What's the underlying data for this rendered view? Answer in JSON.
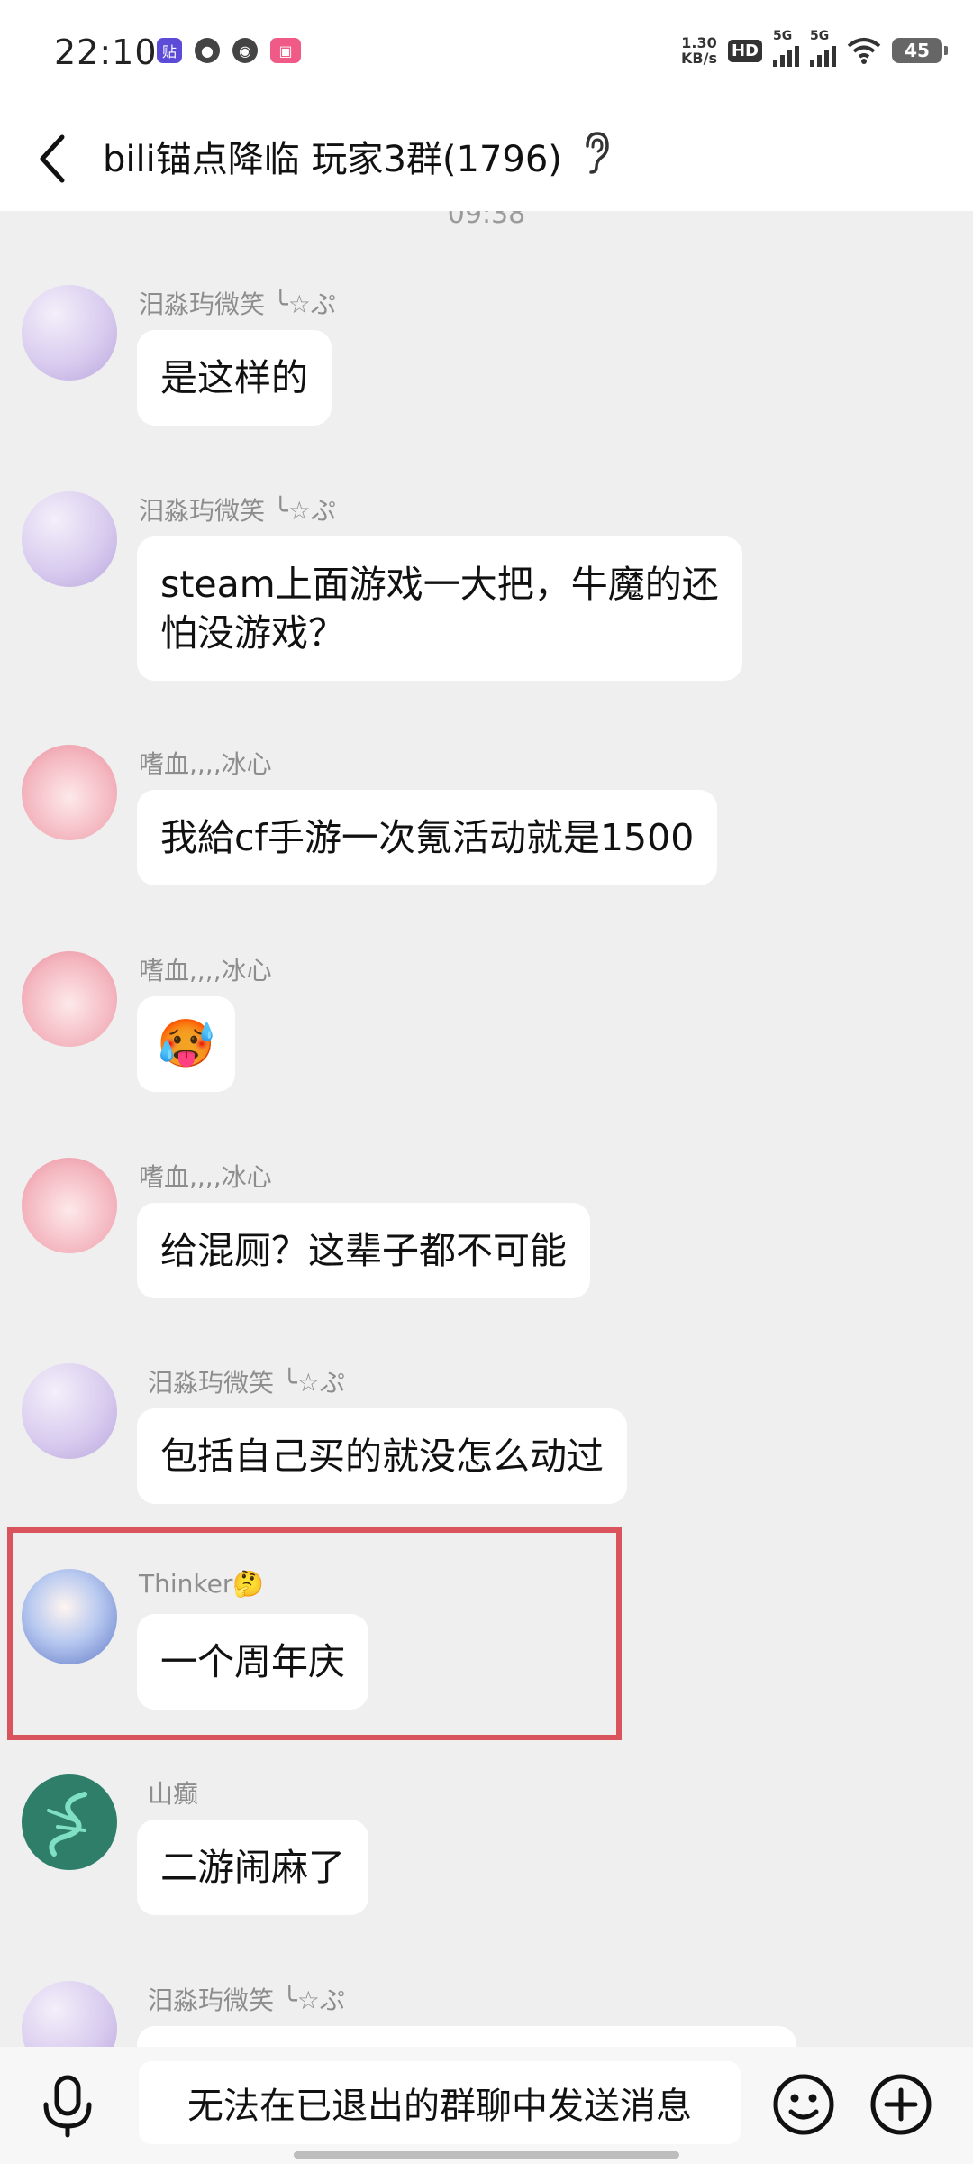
{
  "status_bar": {
    "time": "22:10",
    "net_speed_value": "1.30",
    "net_speed_unit": "KB/s",
    "hd_label": "HD",
    "signal_1_label": "5G",
    "signal_2_label": "5G",
    "battery": "45",
    "app_icons": [
      "tieba-icon",
      "message-icon",
      "wechat-icon",
      "bilibili-icon"
    ]
  },
  "header": {
    "title": "bili锚点降临 玩家3群(1796)",
    "ear_icon": "ear-icon"
  },
  "chat": {
    "timestamp": "09:38",
    "messages": [
      {
        "sender": "汨淼玙微笑 ╰☆ぷ",
        "text": "是这样的"
      },
      {
        "sender": "汨淼玙微笑 ╰☆ぷ",
        "text": "steam上面游戏一大把，牛魔的还\n怕没游戏？"
      },
      {
        "sender": "嗜血,,,,冰心",
        "text": "我給cf手游一次氪活动就是1500"
      },
      {
        "sender": "嗜血,,,,冰心",
        "text": "🥵"
      },
      {
        "sender": "嗜血,,,,冰心",
        "text": "给混厕？这辈子都不可能"
      },
      {
        "sender": "汨淼玙微笑 ╰☆ぷ",
        "text": "包括自己买的就没怎么动过"
      },
      {
        "sender": "Thinker🤔",
        "text": "一个周年庆"
      },
      {
        "sender": "山癫",
        "text": "二游闹麻了"
      },
      {
        "sender": "汨淼玙微笑 ╰☆ぷ",
        "text": ""
      }
    ]
  },
  "input": {
    "disabled_text": "无法在已退出的群聊中发送消息"
  },
  "colors": {
    "background": "#efefef",
    "bubble": "#ffffff",
    "highlight": "#d9545c"
  }
}
